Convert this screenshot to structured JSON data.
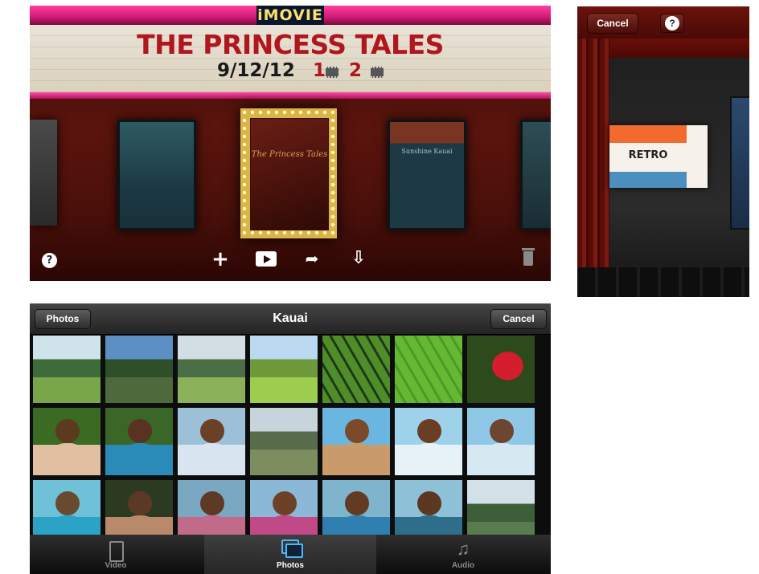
{
  "theater": {
    "logo": "iMOVIE",
    "marquee_title": "THE PRINCESS TALES",
    "marquee_date": "9/12/12",
    "clips_count": "1",
    "photos_count": "2",
    "center_poster_title": "The Princess Tales",
    "side_poster_title": "Sunshine Kauai"
  },
  "theme_picker": {
    "cancel_label": "Cancel",
    "help_label": "?",
    "theme_name": "RETRO"
  },
  "photo_picker": {
    "back_label": "Photos",
    "album_title": "Kauai",
    "cancel_label": "Cancel",
    "tabs": [
      {
        "label": "Video",
        "icon": "film-icon",
        "selected": false
      },
      {
        "label": "Photos",
        "icon": "photos-icon",
        "selected": true
      },
      {
        "label": "Audio",
        "icon": "music-note-icon",
        "selected": false
      }
    ],
    "photos": [
      {
        "kind": "landscape",
        "sky": "#cfe3ea",
        "mid": "#3d6b3a",
        "ground": "#7aa64a"
      },
      {
        "kind": "landscape",
        "sky": "#5c8fc4",
        "mid": "#2f4f2a",
        "ground": "#4e6a3c"
      },
      {
        "kind": "landscape",
        "sky": "#d3dde4",
        "mid": "#4c6e46",
        "ground": "#8bb25a"
      },
      {
        "kind": "landscape",
        "sky": "#bad8ef",
        "mid": "#6f9a3b",
        "ground": "#9ccd4e"
      },
      {
        "kind": "leaf",
        "sky": "#1e3a14",
        "mid": "#4f8c2a",
        "ground": "#2b5216"
      },
      {
        "kind": "leaf",
        "sky": "#4a9a26",
        "mid": "#66b833",
        "ground": "#2f6c15"
      },
      {
        "kind": "flower",
        "sky": "#2c4a1c",
        "mid": "#d41e2e",
        "ground": "#264016"
      },
      {
        "kind": "person",
        "sky": "#3b6a22",
        "mid": "#5c3a1e",
        "ground": "#e0c0a0"
      },
      {
        "kind": "person",
        "sky": "#3a6628",
        "mid": "#5a3320",
        "ground": "#2a8ab8"
      },
      {
        "kind": "person",
        "sky": "#9bc0d8",
        "mid": "#6a4026",
        "ground": "#d8e4ef"
      },
      {
        "kind": "landscape",
        "sky": "#c7d4dc",
        "mid": "#586b4a",
        "ground": "#7c8e5f"
      },
      {
        "kind": "person",
        "sky": "#6ab6e0",
        "mid": "#7a4a2a",
        "ground": "#c99a6a"
      },
      {
        "kind": "person",
        "sky": "#9ed2ea",
        "mid": "#6a3e24",
        "ground": "#e7f2f8"
      },
      {
        "kind": "person",
        "sky": "#8fc8e6",
        "mid": "#6e4630",
        "ground": "#d6e8f2"
      },
      {
        "kind": "person",
        "sky": "#6fc1d8",
        "mid": "#6a4a2e",
        "ground": "#2aa3c6"
      },
      {
        "kind": "person",
        "sky": "#2d3a22",
        "mid": "#5a3a24",
        "ground": "#b8896a"
      },
      {
        "kind": "person",
        "sky": "#7aa8c2",
        "mid": "#5e3a24",
        "ground": "#c26a8a"
      },
      {
        "kind": "person",
        "sky": "#8ab8d6",
        "mid": "#6c4128",
        "ground": "#c04a88"
      },
      {
        "kind": "person",
        "sky": "#7eb4cc",
        "mid": "#633a22",
        "ground": "#2f80b0"
      },
      {
        "kind": "person",
        "sky": "#8ec0d8",
        "mid": "#5c3820",
        "ground": "#2e6e8a"
      },
      {
        "kind": "landscape",
        "sky": "#d2e0e8",
        "mid": "#3e5e3a",
        "ground": "#5a7a50"
      }
    ]
  }
}
